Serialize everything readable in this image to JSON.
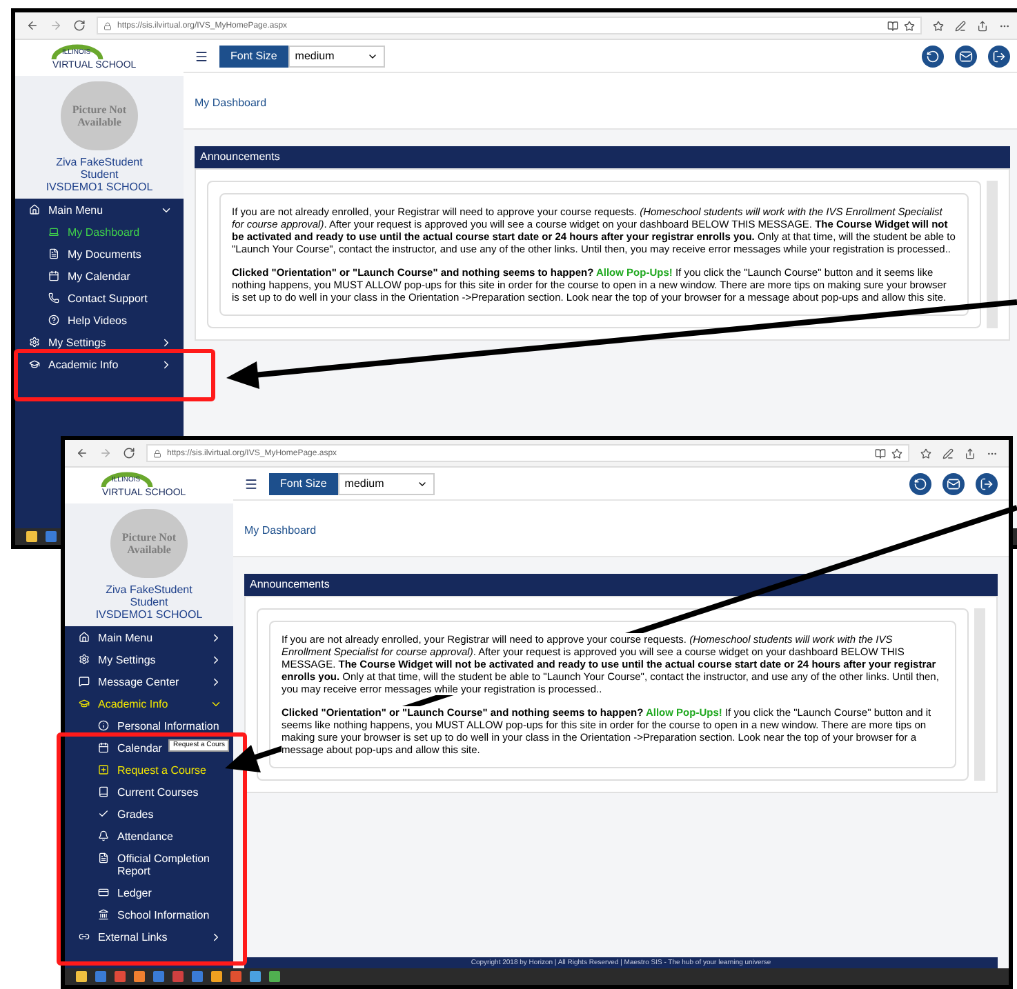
{
  "windows": [
    {
      "browser": {
        "url": "https://sis.ilvirtual.org/IVS_MyHomePage.aspx"
      },
      "logo": {
        "line1": "ILLINOIS",
        "line2": "VIRTUAL SCHOOL"
      },
      "toolbar": {
        "font_size_label": "Font Size",
        "font_size_value": "medium"
      },
      "profile": {
        "photo_text": "Picture Not Available",
        "name": "Ziva FakeStudent",
        "role": "Student",
        "school": "IVSDEMO1 SCHOOL"
      },
      "menu": [
        {
          "label": "Main Menu",
          "kind": "section",
          "expanded": true,
          "selected": false
        },
        {
          "label": "My Dashboard",
          "kind": "sub",
          "selected": true,
          "color": "#3fd14a"
        },
        {
          "label": "My Documents",
          "kind": "sub",
          "selected": false
        },
        {
          "label": "My Calendar",
          "kind": "sub",
          "selected": false
        },
        {
          "label": "Contact Support",
          "kind": "sub",
          "selected": false
        },
        {
          "label": "Help Videos",
          "kind": "sub",
          "selected": false
        },
        {
          "label": "My Settings",
          "kind": "section",
          "expanded": false,
          "selected": false
        },
        {
          "label": "Academic Info",
          "kind": "section",
          "expanded": false,
          "selected": false
        }
      ],
      "breadcrumb": "My Dashboard",
      "panel_title": "Announcements",
      "announcement": [
        [
          {
            "kind": "plain",
            "text": "If you are not already enrolled, your Registrar will need to approve your course requests.  "
          },
          {
            "kind": "italic",
            "text": "(Homeschool students will work with the IVS Enrollment Specialist for course approval)"
          },
          {
            "kind": "plain",
            "text": ". After your request is approved you will see a course widget on your dashboard BELOW THIS MESSAGE. "
          },
          {
            "kind": "bold",
            "text": "The Course Widget will not be activated and ready to use until the actual course start date or 24 hours after your registrar enrolls you."
          },
          {
            "kind": "plain",
            "text": "  Only at that time, will the student be able to \"Launch Your Course\", contact the instructor, and use any of the other links.  Until then, you may receive error messages while your registration is processed.."
          }
        ],
        [
          {
            "kind": "bold",
            "text": "Clicked \"Orientation\" or \"Launch Course\" and nothing seems to happen?"
          },
          {
            "kind": "green",
            "text": "  Allow Pop-Ups!"
          },
          {
            "kind": "plain",
            "text": " If you click the \"Launch Course\" button and it seems like nothing happens, you MUST ALLOW pop-ups for this site in order for the course to open in a new window.  There are more tips on making sure your browser is set up to do well in your class in the Orientation ->Preparation section. Look near the top of your browser for a message about pop-ups and allow this site."
          }
        ]
      ]
    },
    {
      "browser": {
        "url": "https://sis.ilvirtual.org/IVS_MyHomePage.aspx"
      },
      "logo": {
        "line1": "ILLINOIS",
        "line2": "VIRTUAL SCHOOL"
      },
      "toolbar": {
        "font_size_label": "Font Size",
        "font_size_value": "medium"
      },
      "profile": {
        "photo_text": "Picture Not Available",
        "name": "Ziva FakeStudent",
        "role": "Student",
        "school": "IVSDEMO1 SCHOOL"
      },
      "menu": [
        {
          "label": "Main Menu",
          "kind": "section",
          "expanded": false,
          "selected": false
        },
        {
          "label": "My Settings",
          "kind": "section",
          "expanded": false,
          "selected": false
        },
        {
          "label": "Message Center",
          "kind": "section",
          "expanded": false,
          "selected": false
        },
        {
          "label": "Academic Info",
          "kind": "section",
          "expanded": true,
          "selected": true,
          "color": "#f2e600"
        },
        {
          "label": "Personal Information",
          "kind": "sub",
          "selected": false
        },
        {
          "label": "Calendar",
          "kind": "sub",
          "selected": false
        },
        {
          "label": "Request a Course",
          "kind": "sub",
          "selected": true,
          "color": "#f2e600"
        },
        {
          "label": "Current Courses",
          "kind": "sub",
          "selected": false
        },
        {
          "label": "Grades",
          "kind": "sub",
          "selected": false
        },
        {
          "label": "Attendance",
          "kind": "sub",
          "selected": false
        },
        {
          "label": "Official Completion Report",
          "kind": "sub",
          "selected": false
        },
        {
          "label": "Ledger",
          "kind": "sub",
          "selected": false
        },
        {
          "label": "School Information",
          "kind": "sub",
          "selected": false
        },
        {
          "label": "External Links",
          "kind": "section",
          "expanded": false,
          "selected": false
        }
      ],
      "tooltip": "Request a Cours",
      "breadcrumb": "My Dashboard",
      "panel_title": "Announcements",
      "announcement": [
        [
          {
            "kind": "plain",
            "text": "If you are not already enrolled, your Registrar will need to approve your course requests.  "
          },
          {
            "kind": "italic",
            "text": "(Homeschool students will work with the IVS Enrollment Specialist for course approval)"
          },
          {
            "kind": "plain",
            "text": ". After your request is approved you will see a course widget on your dashboard BELOW THIS MESSAGE. "
          },
          {
            "kind": "bold",
            "text": "The Course Widget will not be activated and ready to use until the actual course start date or 24 hours after your registrar enrolls you."
          },
          {
            "kind": "plain",
            "text": "  Only at that time, will the student be able to \"Launch Your Course\", contact the instructor, and use any of the other links.  Until then, you may receive error messages while your registration is processed.."
          }
        ],
        [
          {
            "kind": "bold",
            "text": "Clicked \"Orientation\" or \"Launch Course\" and nothing seems to happen?"
          },
          {
            "kind": "green",
            "text": "  Allow Pop-Ups!"
          },
          {
            "kind": "plain",
            "text": " If you click the \"Launch Course\" button and it seems like nothing happens, you MUST ALLOW pop-ups for this site in order for the course to open in a new window.  There are more tips on making sure your browser is set up to do well in your class in the Orientation ->Preparation section. Look near the top of your browser for a message about pop-ups and allow this site."
          }
        ]
      ],
      "footer": "Copyright 2018 by Horizon | All Rights Reserved | Maestro SIS - The hub of your learning universe"
    }
  ]
}
